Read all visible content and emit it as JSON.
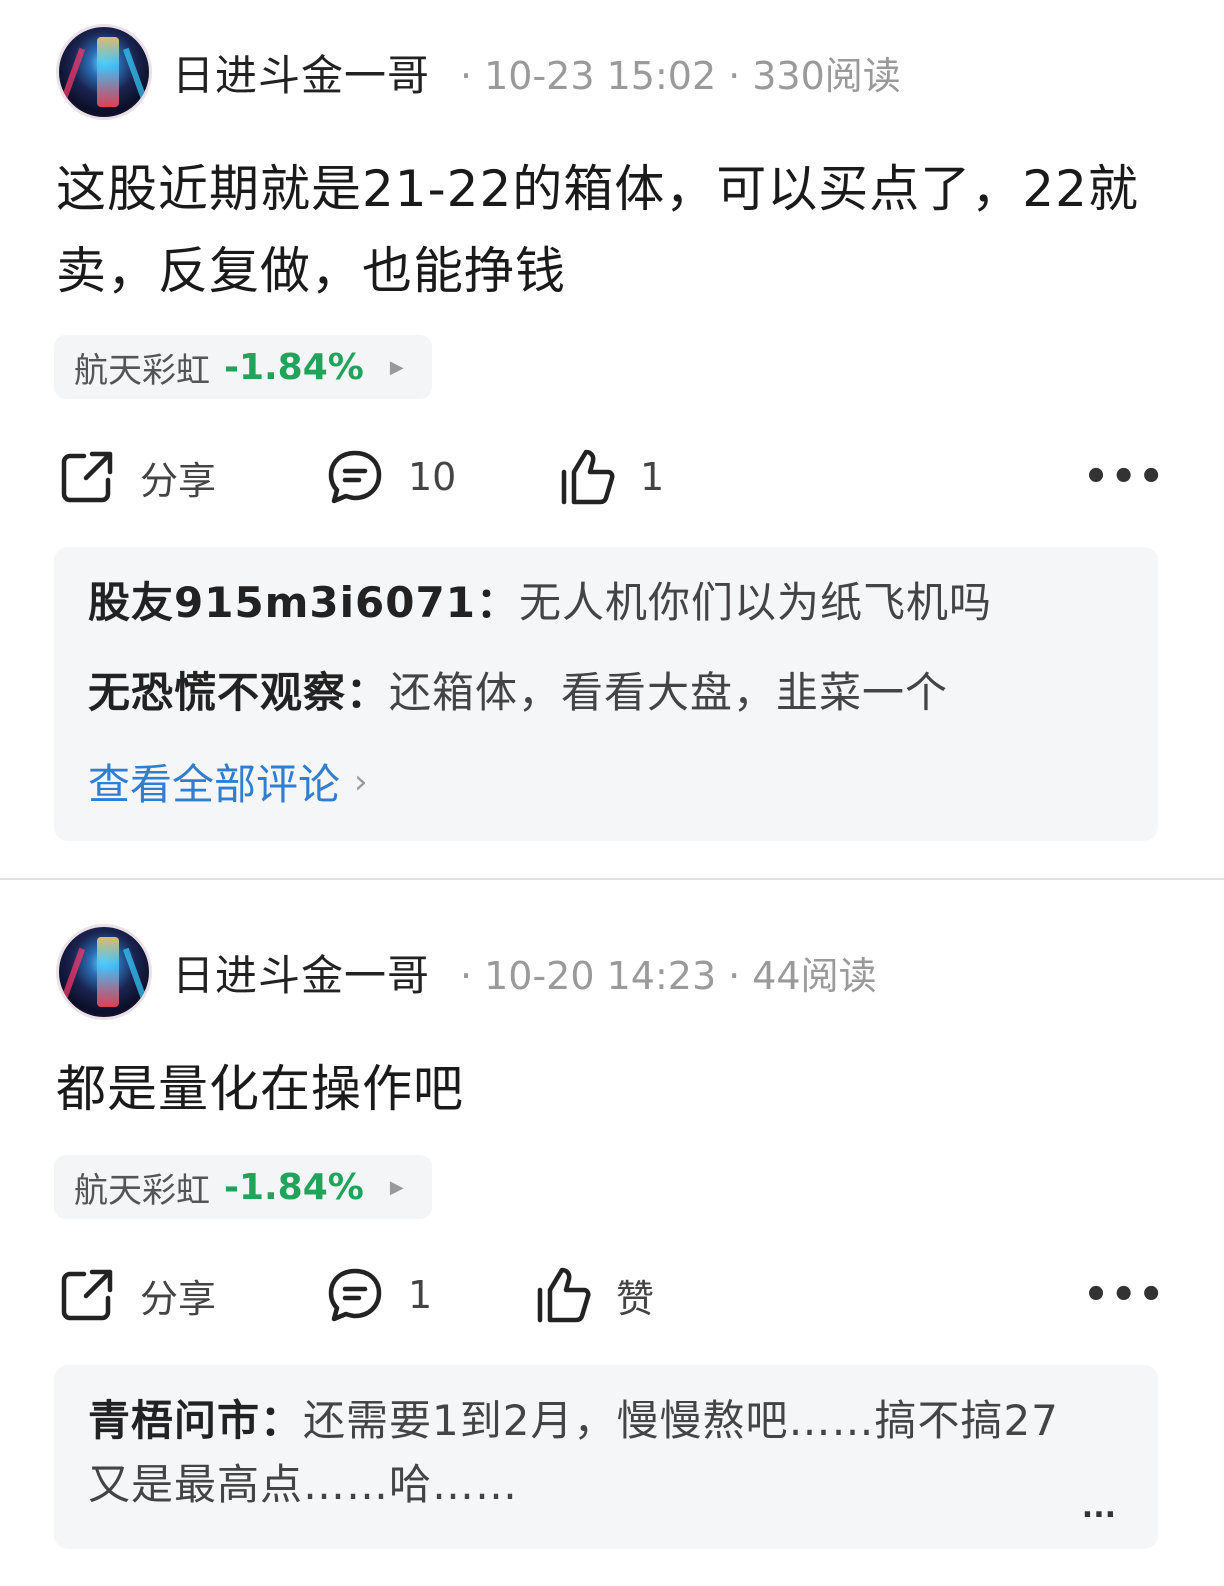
{
  "posts": [
    {
      "author": "日进斗金一哥",
      "time": "10-23 15:02",
      "reads": "330阅读",
      "content": "这股近期就是21-22的箱体，可以买点了，22就卖，反复做，也能挣钱",
      "stock": {
        "name": "航天彩虹",
        "change": "-1.84%"
      },
      "actions": {
        "share": "分享",
        "comments": "10",
        "likes": "1"
      },
      "comments": [
        {
          "author": "股友915m3i6071：",
          "text": "无人机你们以为纸飞机吗"
        },
        {
          "author": "无恐慌不观察：",
          "text": "还箱体，看看大盘，韭菜一个"
        }
      ],
      "view_all": "查看全部评论"
    },
    {
      "author": "日进斗金一哥",
      "time": "10-20 14:23",
      "reads": "44阅读",
      "content": "都是量化在操作吧",
      "stock": {
        "name": "航天彩虹",
        "change": "-1.84%"
      },
      "actions": {
        "share": "分享",
        "comments": "1",
        "likes": "赞"
      },
      "comments": [
        {
          "author": "青梧问市：",
          "text": "还需要1到2月，慢慢熬吧……搞不搞27又是最高点……哈……"
        }
      ],
      "more": "..."
    }
  ],
  "colors": {
    "stock_down": "#22a35a",
    "link": "#2f7ecf",
    "meta": "#9a9a9a"
  },
  "icons": {
    "share": "share-icon",
    "comment": "comment-icon",
    "like": "thumbs-up-icon",
    "more": "more-icon"
  }
}
